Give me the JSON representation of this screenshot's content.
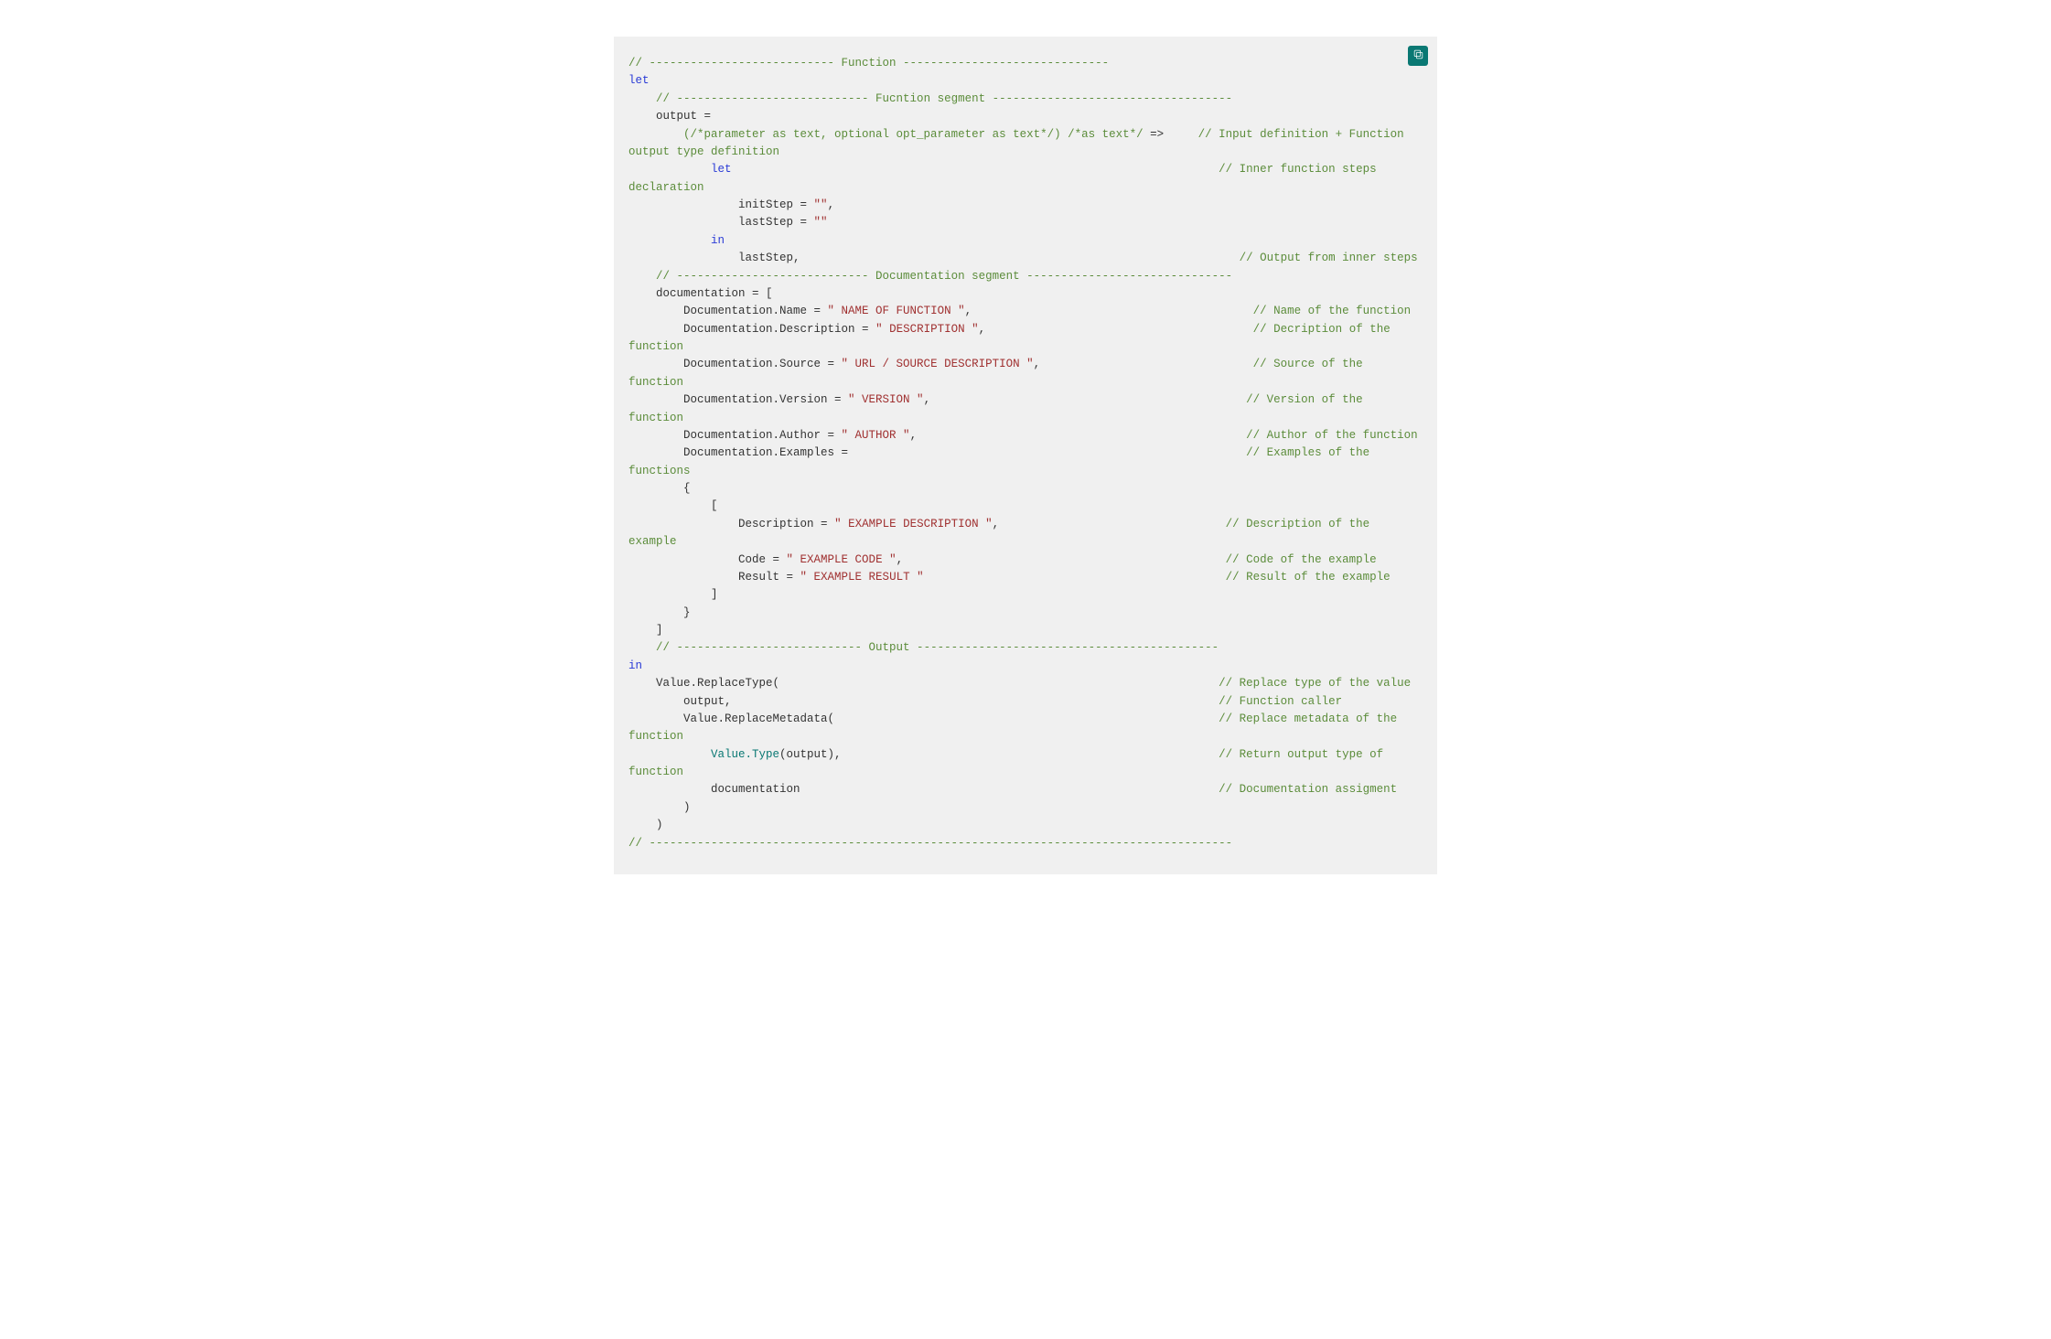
{
  "copy_icon_name": "copy-icon",
  "code": {
    "l1_cmt": "// --------------------------- Function ------------------------------",
    "l2_kw": "let",
    "l3_cmt": "    // ---------------------------- Fucntion segment -----------------------------------",
    "l4_plain": "    output =",
    "l5_a": "        ",
    "l5_b_cmt": "(/*parameter as text, optional opt_parameter as text*/) /*as text*/",
    "l5_c_op": " =>",
    "l5_d_pad": "     ",
    "l5_e_cmt": "// Input definition + Function output type definition",
    "l6_a": "            ",
    "l6_b_kw": "let",
    "l6_c_pad": "                                                                       ",
    "l6_d_cmt": "// Inner function steps declaration",
    "l7_a": "                initStep = ",
    "l7_b_str": "\"\"",
    "l7_c": ",",
    "l8_a": "                lastStep = ",
    "l8_b_str": "\"\"",
    "l9_a": "            ",
    "l9_b_kw": "in",
    "l10_a": "                lastStep,",
    "l10_b_pad": "                                                                ",
    "l10_c_cmt": "// Output from inner steps",
    "l11_cmt": "    // ---------------------------- Documentation segment ------------------------------",
    "l12_plain": "    documentation = [",
    "l13_a": "        Documentation.Name = ",
    "l13_b_str": "\" NAME OF FUNCTION \"",
    "l13_c": ",",
    "l13_d_pad": "                                         ",
    "l13_e_cmt": "// Name of the function",
    "l14_a": "        Documentation.Description = ",
    "l14_b_str": "\" DESCRIPTION \"",
    "l14_c": ",",
    "l14_d_pad": "                                       ",
    "l14_e_cmt": "// Decription of the function",
    "l15_a": "        Documentation.Source = ",
    "l15_b_str": "\" URL / SOURCE DESCRIPTION \"",
    "l15_c": ",",
    "l15_d_pad": "                               ",
    "l15_e_cmt": "// Source of the function",
    "l16_a": "        Documentation.Version = ",
    "l16_b_str": "\" VERSION \"",
    "l16_c": ",",
    "l16_d_pad": "                                              ",
    "l16_e_cmt": "// Version of the function",
    "l17_a": "        Documentation.Author = ",
    "l17_b_str": "\" AUTHOR \"",
    "l17_c": ",",
    "l17_d_pad": "                                                ",
    "l17_e_cmt": "// Author of the function",
    "l18_a": "        Documentation.Examples =",
    "l18_b_pad": "                                                          ",
    "l18_c_cmt": "// Examples of the functions",
    "l19_plain": "        {",
    "l20_plain": "            [",
    "l21_a": "                Description = ",
    "l21_b_str": "\" EXAMPLE DESCRIPTION \"",
    "l21_c": ",",
    "l21_d_pad": "                                 ",
    "l21_e_cmt": "// Description of the example",
    "l22_a": "                Code = ",
    "l22_b_str": "\" EXAMPLE CODE \"",
    "l22_c": ",",
    "l22_d_pad": "                                               ",
    "l22_e_cmt": "// Code of the example",
    "l23_a": "                Result = ",
    "l23_b_str": "\" EXAMPLE RESULT \"",
    "l23_c_pad": "                                            ",
    "l23_d_cmt": "// Result of the example",
    "l24_plain": "            ]",
    "l25_plain": "        }",
    "l26_plain": "    ]",
    "l27_cmt": "    // --------------------------- Output --------------------------------------------",
    "l28_kw": "in",
    "l29_a": "    Value.ReplaceType(",
    "l29_b_pad": "                                                                ",
    "l29_c_cmt": "// Replace type of the value",
    "l30_a": "        output,",
    "l30_b_pad": "                                                                       ",
    "l30_c_cmt": "// Function caller",
    "l31_a": "        Value.ReplaceMetadata(",
    "l31_b_pad": "                                                        ",
    "l31_c_cmt": "// Replace metadata of the function",
    "l32_a": "            ",
    "l32_b_id": "Value.Type",
    "l32_c": "(output),",
    "l32_d_pad": "                                                       ",
    "l32_e_cmt": "// Return output type of function",
    "l33_a": "            documentation",
    "l33_b_pad": "                                                             ",
    "l33_c_cmt": "// Documentation assigment",
    "l34_plain": "        )",
    "l35_plain": "    )",
    "l36_cmt": "// -------------------------------------------------------------------------------------"
  }
}
